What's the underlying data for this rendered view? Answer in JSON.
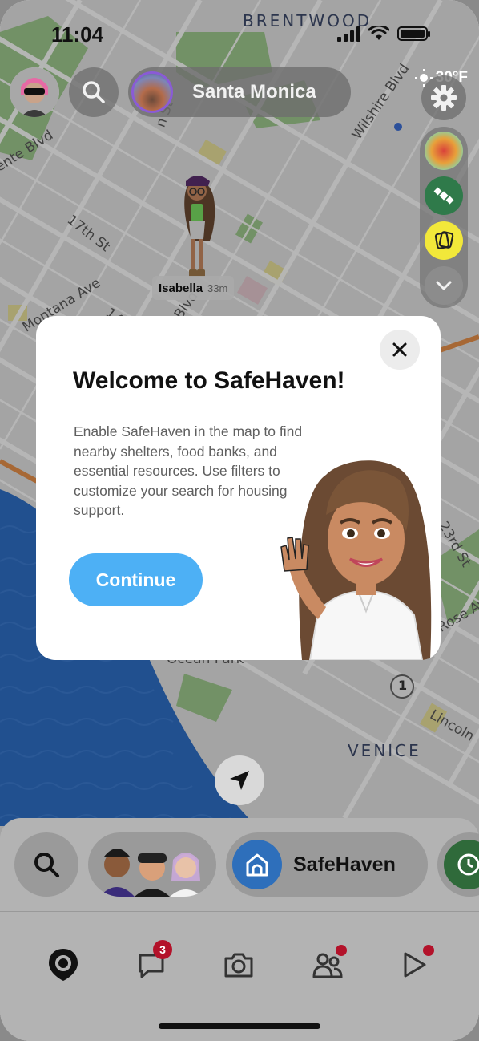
{
  "status_bar": {
    "time": "11:04"
  },
  "map": {
    "labels": {
      "brentwood": "BRENTWOOD",
      "venice": "VENICE",
      "ocean_park": "Ocean Park",
      "montana_ave": "Montana Ave",
      "seventeenth_st": "17th St",
      "fourteenth": "14th",
      "wilshire_blvd": "Wilshire Blvd",
      "vicente_blvd": "ente Blvd",
      "twentythird_st": "23rd St",
      "lincoln": "Lincoln",
      "rose_av": "Rose Av",
      "blvd": "Blvd",
      "n_st": "n St",
      "route_marker": "1"
    },
    "friend": {
      "name": "Isabella",
      "time_ago": "33m"
    }
  },
  "top_bar": {
    "location": "Santa Monica",
    "temperature": "30°F"
  },
  "modal": {
    "title": "Welcome to SafeHaven!",
    "body": "Enable SafeHaven in the map to find nearby shelters, food banks, and essential resources. Use filters to customize your search for housing support.",
    "continue_label": "Continue"
  },
  "tray": {
    "safehaven_label": "SafeHaven"
  },
  "nav": {
    "chat_badge": "3"
  },
  "colors": {
    "accent_blue": "#4db0f5",
    "safehaven_blue": "#2e6fbb",
    "notification_red": "#b3122a"
  }
}
